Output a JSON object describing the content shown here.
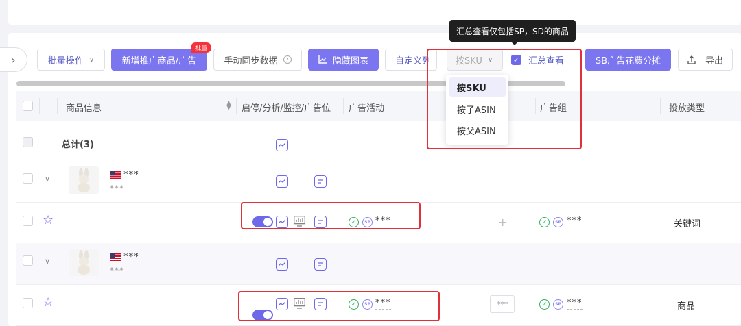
{
  "toolbar": {
    "batch_ops": "批量操作",
    "add_promo": "新增推广商品/广告",
    "batch_badge": "批量",
    "manual_sync": "手动同步数据",
    "hide_chart": "隐藏图表",
    "custom_cols": "自定义列",
    "group_select_value": "按SKU",
    "summary_view": "汇总查看",
    "sb_split": "SB广告花费分摊",
    "export": "导出"
  },
  "tooltip": {
    "text": "汇总查看仅包括SP，SD的商品"
  },
  "dropdown": {
    "options": [
      "按SKU",
      "按子ASIN",
      "按父ASIN"
    ],
    "selected": "按SKU"
  },
  "table": {
    "headers": {
      "product": "商品信息",
      "actions": "启停/分析/监控/广告位",
      "campaign": "广告活动",
      "adgroup": "广告组",
      "target_type": "投放类型"
    },
    "total_label": "总计(3)",
    "rows": [
      {
        "name": "***",
        "sub": "***"
      },
      {
        "campaign": "***",
        "adgroup": "***",
        "target_type": "关键词"
      },
      {
        "name": "***",
        "sub": "***"
      },
      {
        "campaign": "***",
        "bid": "***",
        "adgroup": "***",
        "target_type": "商品"
      }
    ]
  },
  "icons": [
    "chevron-right-icon",
    "caret-down-icon",
    "help-icon",
    "chart-icon",
    "export-icon",
    "check-icon",
    "star-icon",
    "trend-icon",
    "list-icon",
    "bar-icon",
    "plus-icon"
  ],
  "colors": {
    "primary": "#7b75ef",
    "highlight_red": "#e0303a",
    "ok_green": "#2fb35a"
  }
}
